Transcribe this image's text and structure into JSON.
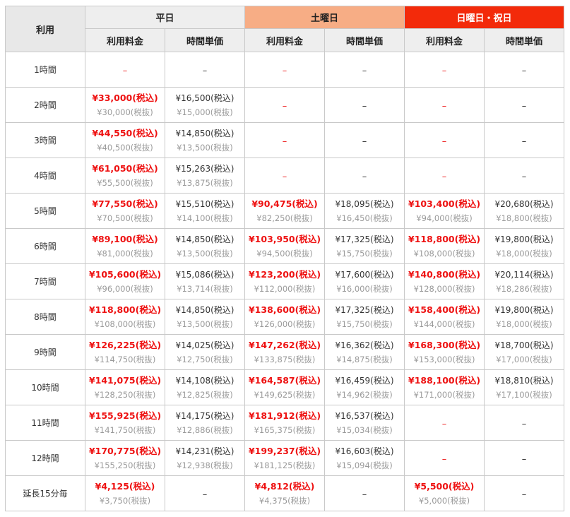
{
  "header": {
    "usage": "利用",
    "weekday": "平日",
    "saturday": "土曜日",
    "sunday_holiday": "日曜日・祝日",
    "fee": "利用料金",
    "unit": "時間単価"
  },
  "colors": {
    "saturday_header": "#f7ad85",
    "sunday_header": "#f32a0a",
    "price_red": "#ee1111",
    "tax_gray": "#9a9a9a"
  },
  "dash": "–",
  "rows": [
    {
      "label": "1時間",
      "wd": null,
      "sat": null,
      "sun": null
    },
    {
      "label": "2時間",
      "wd": {
        "fi": "¥33,000(税込)",
        "fe": "¥30,000(税抜)",
        "ui": "¥16,500(税込)",
        "ue": "¥15,000(税抜)"
      },
      "sat": null,
      "sun": null
    },
    {
      "label": "3時間",
      "wd": {
        "fi": "¥44,550(税込)",
        "fe": "¥40,500(税抜)",
        "ui": "¥14,850(税込)",
        "ue": "¥13,500(税抜)"
      },
      "sat": null,
      "sun": null
    },
    {
      "label": "4時間",
      "wd": {
        "fi": "¥61,050(税込)",
        "fe": "¥55,500(税抜)",
        "ui": "¥15,263(税込)",
        "ue": "¥13,875(税抜)"
      },
      "sat": null,
      "sun": null
    },
    {
      "label": "5時間",
      "wd": {
        "fi": "¥77,550(税込)",
        "fe": "¥70,500(税抜)",
        "ui": "¥15,510(税込)",
        "ue": "¥14,100(税抜)"
      },
      "sat": {
        "fi": "¥90,475(税込)",
        "fe": "¥82,250(税抜)",
        "ui": "¥18,095(税込)",
        "ue": "¥16,450(税抜)"
      },
      "sun": {
        "fi": "¥103,400(税込)",
        "fe": "¥94,000(税抜)",
        "ui": "¥20,680(税込)",
        "ue": "¥18,800(税抜)"
      }
    },
    {
      "label": "6時間",
      "wd": {
        "fi": "¥89,100(税込)",
        "fe": "¥81,000(税抜)",
        "ui": "¥14,850(税込)",
        "ue": "¥13,500(税抜)"
      },
      "sat": {
        "fi": "¥103,950(税込)",
        "fe": "¥94,500(税抜)",
        "ui": "¥17,325(税込)",
        "ue": "¥15,750(税抜)"
      },
      "sun": {
        "fi": "¥118,800(税込)",
        "fe": "¥108,000(税抜)",
        "ui": "¥19,800(税込)",
        "ue": "¥18,000(税抜)"
      }
    },
    {
      "label": "7時間",
      "wd": {
        "fi": "¥105,600(税込)",
        "fe": "¥96,000(税抜)",
        "ui": "¥15,086(税込)",
        "ue": "¥13,714(税抜)"
      },
      "sat": {
        "fi": "¥123,200(税込)",
        "fe": "¥112,000(税抜)",
        "ui": "¥17,600(税込)",
        "ue": "¥16,000(税抜)"
      },
      "sun": {
        "fi": "¥140,800(税込)",
        "fe": "¥128,000(税抜)",
        "ui": "¥20,114(税込)",
        "ue": "¥18,286(税抜)"
      }
    },
    {
      "label": "8時間",
      "wd": {
        "fi": "¥118,800(税込)",
        "fe": "¥108,000(税抜)",
        "ui": "¥14,850(税込)",
        "ue": "¥13,500(税抜)"
      },
      "sat": {
        "fi": "¥138,600(税込)",
        "fe": "¥126,000(税抜)",
        "ui": "¥17,325(税込)",
        "ue": "¥15,750(税抜)"
      },
      "sun": {
        "fi": "¥158,400(税込)",
        "fe": "¥144,000(税抜)",
        "ui": "¥19,800(税込)",
        "ue": "¥18,000(税抜)"
      }
    },
    {
      "label": "9時間",
      "wd": {
        "fi": "¥126,225(税込)",
        "fe": "¥114,750(税抜)",
        "ui": "¥14,025(税込)",
        "ue": "¥12,750(税抜)"
      },
      "sat": {
        "fi": "¥147,262(税込)",
        "fe": "¥133,875(税抜)",
        "ui": "¥16,362(税込)",
        "ue": "¥14,875(税抜)"
      },
      "sun": {
        "fi": "¥168,300(税込)",
        "fe": "¥153,000(税抜)",
        "ui": "¥18,700(税込)",
        "ue": "¥17,000(税抜)"
      }
    },
    {
      "label": "10時間",
      "wd": {
        "fi": "¥141,075(税込)",
        "fe": "¥128,250(税抜)",
        "ui": "¥14,108(税込)",
        "ue": "¥12,825(税抜)"
      },
      "sat": {
        "fi": "¥164,587(税込)",
        "fe": "¥149,625(税抜)",
        "ui": "¥16,459(税込)",
        "ue": "¥14,962(税抜)"
      },
      "sun": {
        "fi": "¥188,100(税込)",
        "fe": "¥171,000(税抜)",
        "ui": "¥18,810(税込)",
        "ue": "¥17,100(税抜)"
      }
    },
    {
      "label": "11時間",
      "wd": {
        "fi": "¥155,925(税込)",
        "fe": "¥141,750(税抜)",
        "ui": "¥14,175(税込)",
        "ue": "¥12,886(税抜)"
      },
      "sat": {
        "fi": "¥181,912(税込)",
        "fe": "¥165,375(税抜)",
        "ui": "¥16,537(税込)",
        "ue": "¥15,034(税抜)"
      },
      "sun": null
    },
    {
      "label": "12時間",
      "wd": {
        "fi": "¥170,775(税込)",
        "fe": "¥155,250(税抜)",
        "ui": "¥14,231(税込)",
        "ue": "¥12,938(税抜)"
      },
      "sat": {
        "fi": "¥199,237(税込)",
        "fe": "¥181,125(税抜)",
        "ui": "¥16,603(税込)",
        "ue": "¥15,094(税抜)"
      },
      "sun": null
    },
    {
      "label": "延長15分毎",
      "wd": {
        "fi": "¥4,125(税込)",
        "fe": "¥3,750(税抜)",
        "ui": null,
        "ue": null
      },
      "sat": {
        "fi": "¥4,812(税込)",
        "fe": "¥4,375(税抜)",
        "ui": null,
        "ue": null
      },
      "sun": {
        "fi": "¥5,500(税込)",
        "fe": "¥5,000(税抜)",
        "ui": null,
        "ue": null
      }
    }
  ]
}
